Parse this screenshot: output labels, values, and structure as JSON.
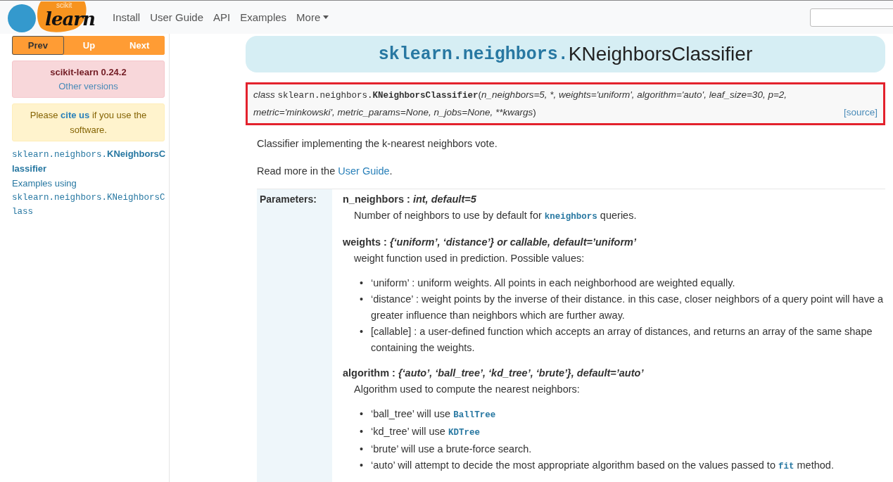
{
  "nav": {
    "logo_caption": "scikit",
    "logo_word": "learn",
    "links": [
      {
        "label": "Install",
        "dropdown": false
      },
      {
        "label": "User Guide",
        "dropdown": false
      },
      {
        "label": "API",
        "dropdown": false
      },
      {
        "label": "Examples",
        "dropdown": false
      },
      {
        "label": "More",
        "dropdown": true
      }
    ]
  },
  "sidebar": {
    "pager": [
      {
        "label": "Prev",
        "selected": true
      },
      {
        "label": "Up",
        "selected": false
      },
      {
        "label": "Next",
        "selected": false
      }
    ],
    "version": {
      "title": "scikit-learn 0.24.2",
      "link": "Other versions"
    },
    "cite": [
      {
        "kind": "text",
        "text": "Please "
      },
      {
        "kind": "bold_link",
        "text": "cite us"
      },
      {
        "kind": "text",
        "text": " if you use the software."
      }
    ],
    "toc": [
      {
        "kind": "code_ref",
        "segments": [
          {
            "kind": "mono",
            "text": "sklearn.neighbors."
          },
          {
            "kind": "bold",
            "text": "KNeighborsClassifier"
          }
        ]
      },
      {
        "kind": "plain",
        "segments": [
          {
            "kind": "text",
            "text": "Examples using"
          }
        ]
      },
      {
        "kind": "code_ref",
        "segments": [
          {
            "kind": "mono",
            "text": "sklearn.neighbors.KNeighborsClass"
          }
        ]
      }
    ]
  },
  "title": {
    "module": "sklearn.neighbors.",
    "name": "KNeighborsClassifier"
  },
  "signature": {
    "highlighted": true,
    "source": "[source]",
    "segments": [
      {
        "kind": "em",
        "text": "class "
      },
      {
        "kind": "mono",
        "text": "sklearn.neighbors."
      },
      {
        "kind": "monobold",
        "text": "KNeighborsClassifier"
      },
      {
        "kind": "text",
        "text": "("
      },
      {
        "kind": "em",
        "text": "n_neighbors=5, *, weights='uniform', algorithm='auto', leaf_size=30, p=2, metric='minkowski', metric_params=None, n_jobs=None, **kwargs"
      },
      {
        "kind": "text",
        "text": ")"
      }
    ]
  },
  "paragraphs": [
    [
      {
        "kind": "text",
        "text": "Classifier implementing the k-nearest neighbors vote."
      }
    ],
    [
      {
        "kind": "text",
        "text": "Read more in the "
      },
      {
        "kind": "link",
        "text": "User Guide"
      },
      {
        "kind": "text",
        "text": "."
      }
    ]
  ],
  "parameters": {
    "label": "Parameters:",
    "items": [
      {
        "name": "n_neighbors :",
        "type": "int, default=5",
        "description": [
          {
            "kind": "text",
            "text": "Number of neighbors to use by default for "
          },
          {
            "kind": "code_link",
            "text": "kneighbors"
          },
          {
            "kind": "text",
            "text": " queries."
          }
        ]
      },
      {
        "name": "weights :",
        "type": "{‘uniform’, ‘distance’} or callable, default=’uniform’",
        "description": [
          {
            "kind": "text",
            "text": "weight function used in prediction. Possible values:"
          }
        ],
        "bullets": [
          {
            "marker": "•",
            "segments": [
              {
                "kind": "text",
                "text": "‘uniform’ : uniform weights. All points in each neighborhood are weighted equally."
              }
            ]
          },
          {
            "marker": "•",
            "segments": [
              {
                "kind": "text",
                "text": "‘distance’ : weight points by the inverse of their distance. in this case, closer neighbors of a query point will have a greater influence than neighbors which are further away."
              }
            ]
          },
          {
            "marker": "•",
            "segments": [
              {
                "kind": "text",
                "text": "[callable] : a user-defined function which accepts an array of distances, and returns an array of the same shape containing the weights."
              }
            ]
          }
        ]
      },
      {
        "name": "algorithm :",
        "type": "{‘auto’, ‘ball_tree’, ‘kd_tree’, ‘brute’}, default=’auto’",
        "description": [
          {
            "kind": "text",
            "text": "Algorithm used to compute the nearest neighbors:"
          }
        ],
        "bullets": [
          {
            "marker": "•",
            "segments": [
              {
                "kind": "text",
                "text": "‘ball_tree’ will use "
              },
              {
                "kind": "code_link",
                "text": "BallTree"
              }
            ]
          },
          {
            "marker": "•",
            "segments": [
              {
                "kind": "text",
                "text": "‘kd_tree’ will use "
              },
              {
                "kind": "code_link",
                "text": "KDTree"
              }
            ]
          },
          {
            "marker": "•",
            "segments": [
              {
                "kind": "text",
                "text": "‘brute’ will use a brute-force search."
              }
            ]
          },
          {
            "marker": "•",
            "segments": [
              {
                "kind": "text",
                "text": "‘auto’ will attempt to decide the most appropriate algorithm based on the values passed to "
              },
              {
                "kind": "code_link",
                "text": "fit"
              },
              {
                "kind": "text",
                "text": " method."
              }
            ]
          }
        ]
      }
    ]
  }
}
